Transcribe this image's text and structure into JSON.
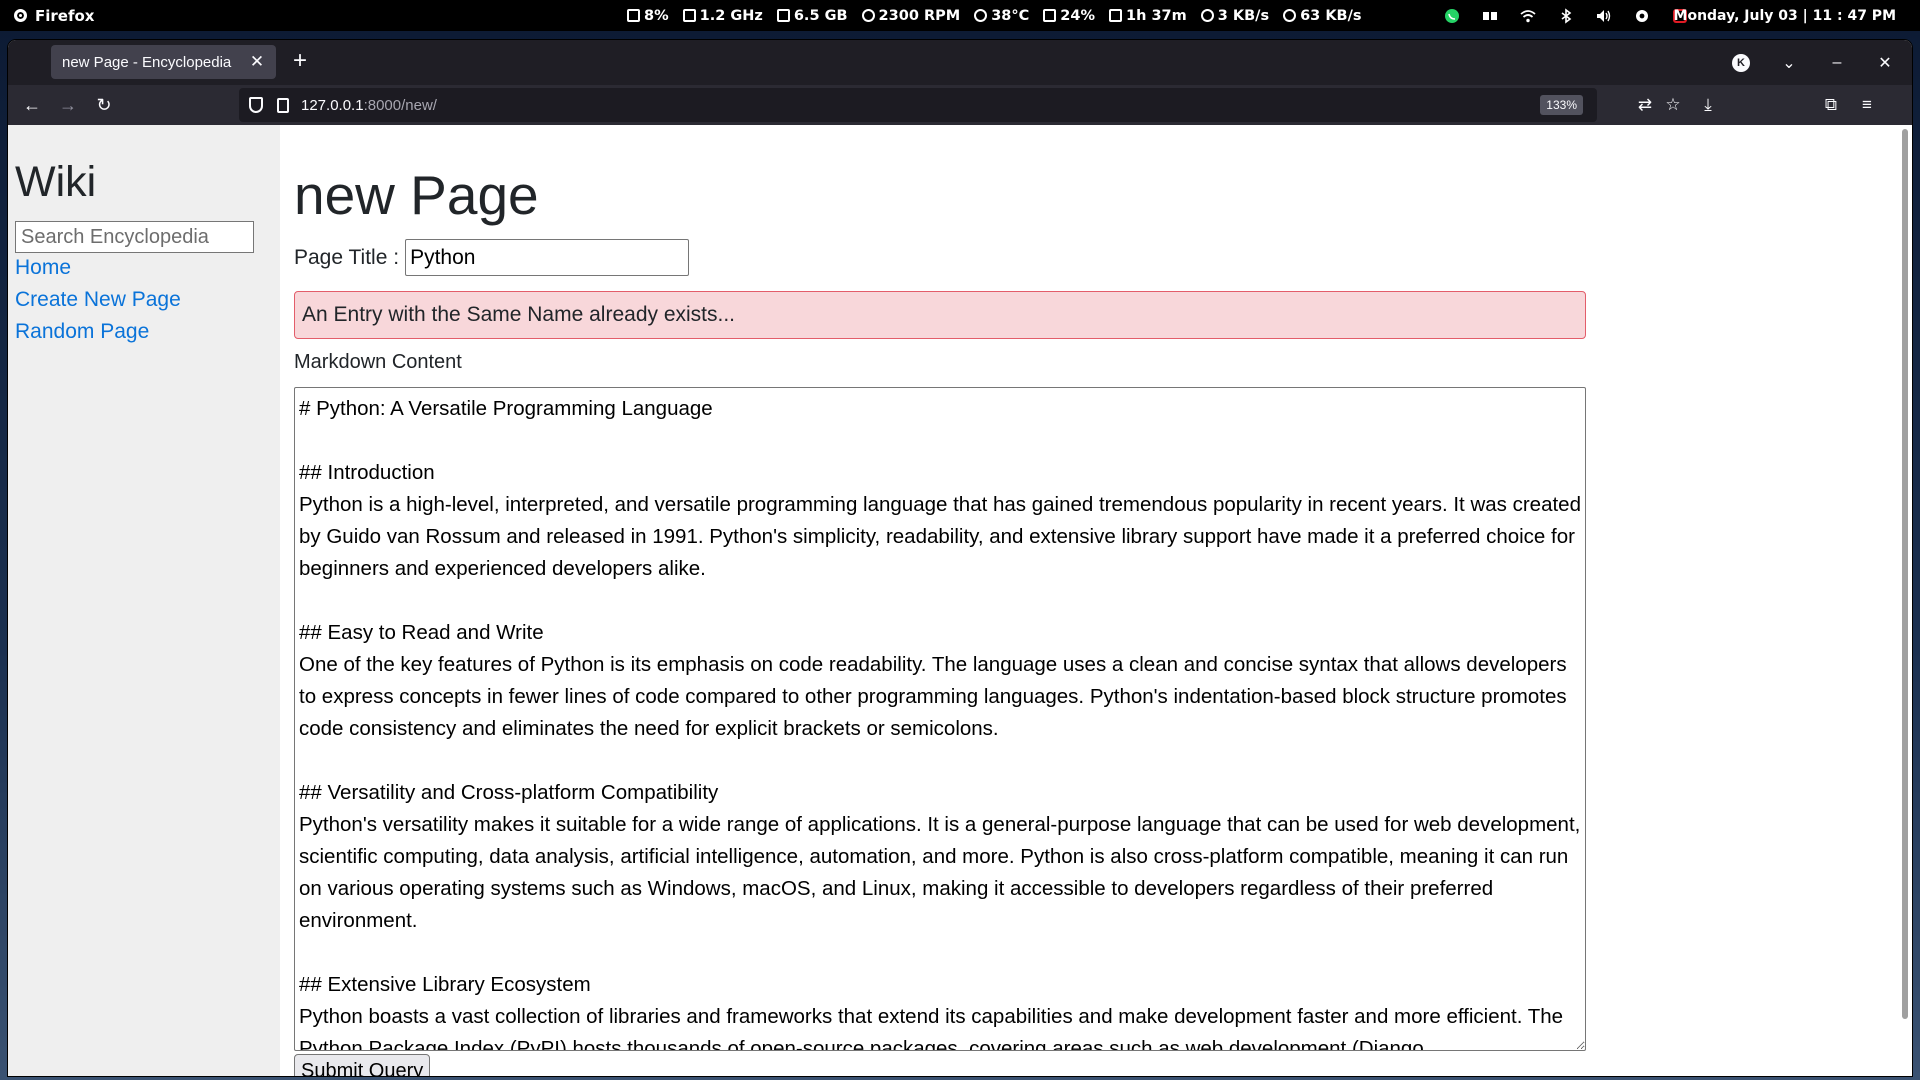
{
  "system_bar": {
    "app_name": "Firefox",
    "stats": {
      "cpu": "8%",
      "freq": "1.2 GHz",
      "mem": "6.5 GB",
      "fan": "2300 RPM",
      "temp": "38°C",
      "battery": "24%",
      "time_left": "1h 37m",
      "upload": "3 KB/s",
      "download": "63 KB/s"
    },
    "clock": "Monday, July 03 | 11 : 47 PM"
  },
  "browser": {
    "tab_title": "new Page - Encyclopedia",
    "account_initial": "K",
    "url_host": "127.0.0.1",
    "url_path": ":8000/new/",
    "zoom": "133%"
  },
  "sidebar": {
    "brand": "Wiki",
    "search_placeholder": "Search Encyclopedia",
    "links": [
      "Home",
      "Create New Page",
      "Random Page"
    ]
  },
  "main": {
    "heading": "new Page",
    "title_label": "Page Title :",
    "title_value": "Python",
    "error": "An Entry with the Same Name already exists...",
    "content_label": "Markdown Content",
    "content": "# Python: A Versatile Programming Language\n\n## Introduction\nPython is a high-level, interpreted, and versatile programming language that has gained tremendous popularity in recent years. It was created by Guido van Rossum and released in 1991. Python's simplicity, readability, and extensive library support have made it a preferred choice for beginners and experienced developers alike.\n\n## Easy to Read and Write\nOne of the key features of Python is its emphasis on code readability. The language uses a clean and concise syntax that allows developers to express concepts in fewer lines of code compared to other programming languages. Python's indentation-based block structure promotes code consistency and eliminates the need for explicit brackets or semicolons.\n\n## Versatility and Cross-platform Compatibility\nPython's versatility makes it suitable for a wide range of applications. It is a general-purpose language that can be used for web development, scientific computing, data analysis, artificial intelligence, automation, and more. Python is also cross-platform compatible, meaning it can run on various operating systems such as Windows, macOS, and Linux, making it accessible to developers regardless of their preferred environment.\n\n## Extensive Library Ecosystem\nPython boasts a vast collection of libraries and frameworks that extend its capabilities and make development faster and more efficient. The Python Package Index (PyPI) hosts thousands of open-source packages, covering areas such as web development (Django,",
    "submit_label": "Submit Query"
  }
}
